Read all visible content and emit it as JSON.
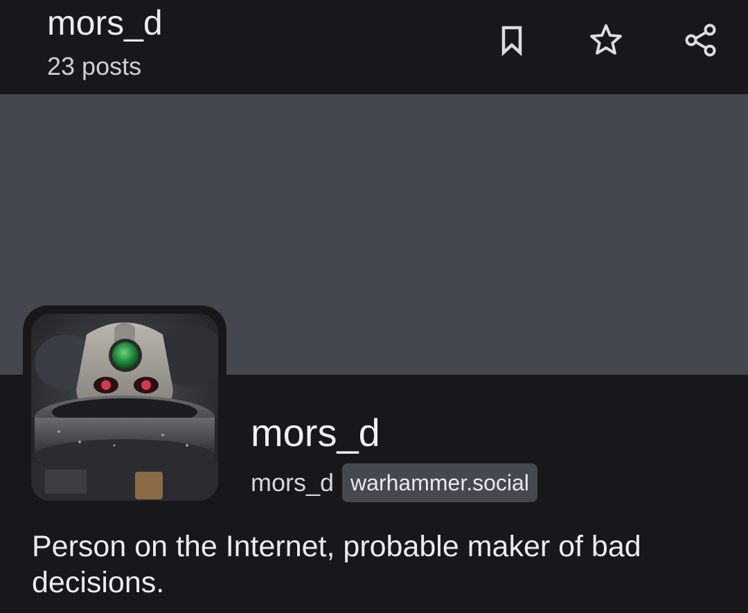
{
  "topbar": {
    "title": "mors_d",
    "post_count": "23 posts",
    "actions": {
      "bookmark_icon": "bookmark-icon",
      "favourite_icon": "star-icon",
      "share_icon": "share-icon"
    }
  },
  "profile": {
    "display_name": "mors_d",
    "handle": "mors_d",
    "domain": "warhammer.social",
    "bio": "Person on the Internet, probable maker of bad decisions."
  },
  "colors": {
    "background": "#17171c",
    "banner": "#44474f",
    "badge": "#45484f",
    "text_primary": "#ededf0"
  }
}
